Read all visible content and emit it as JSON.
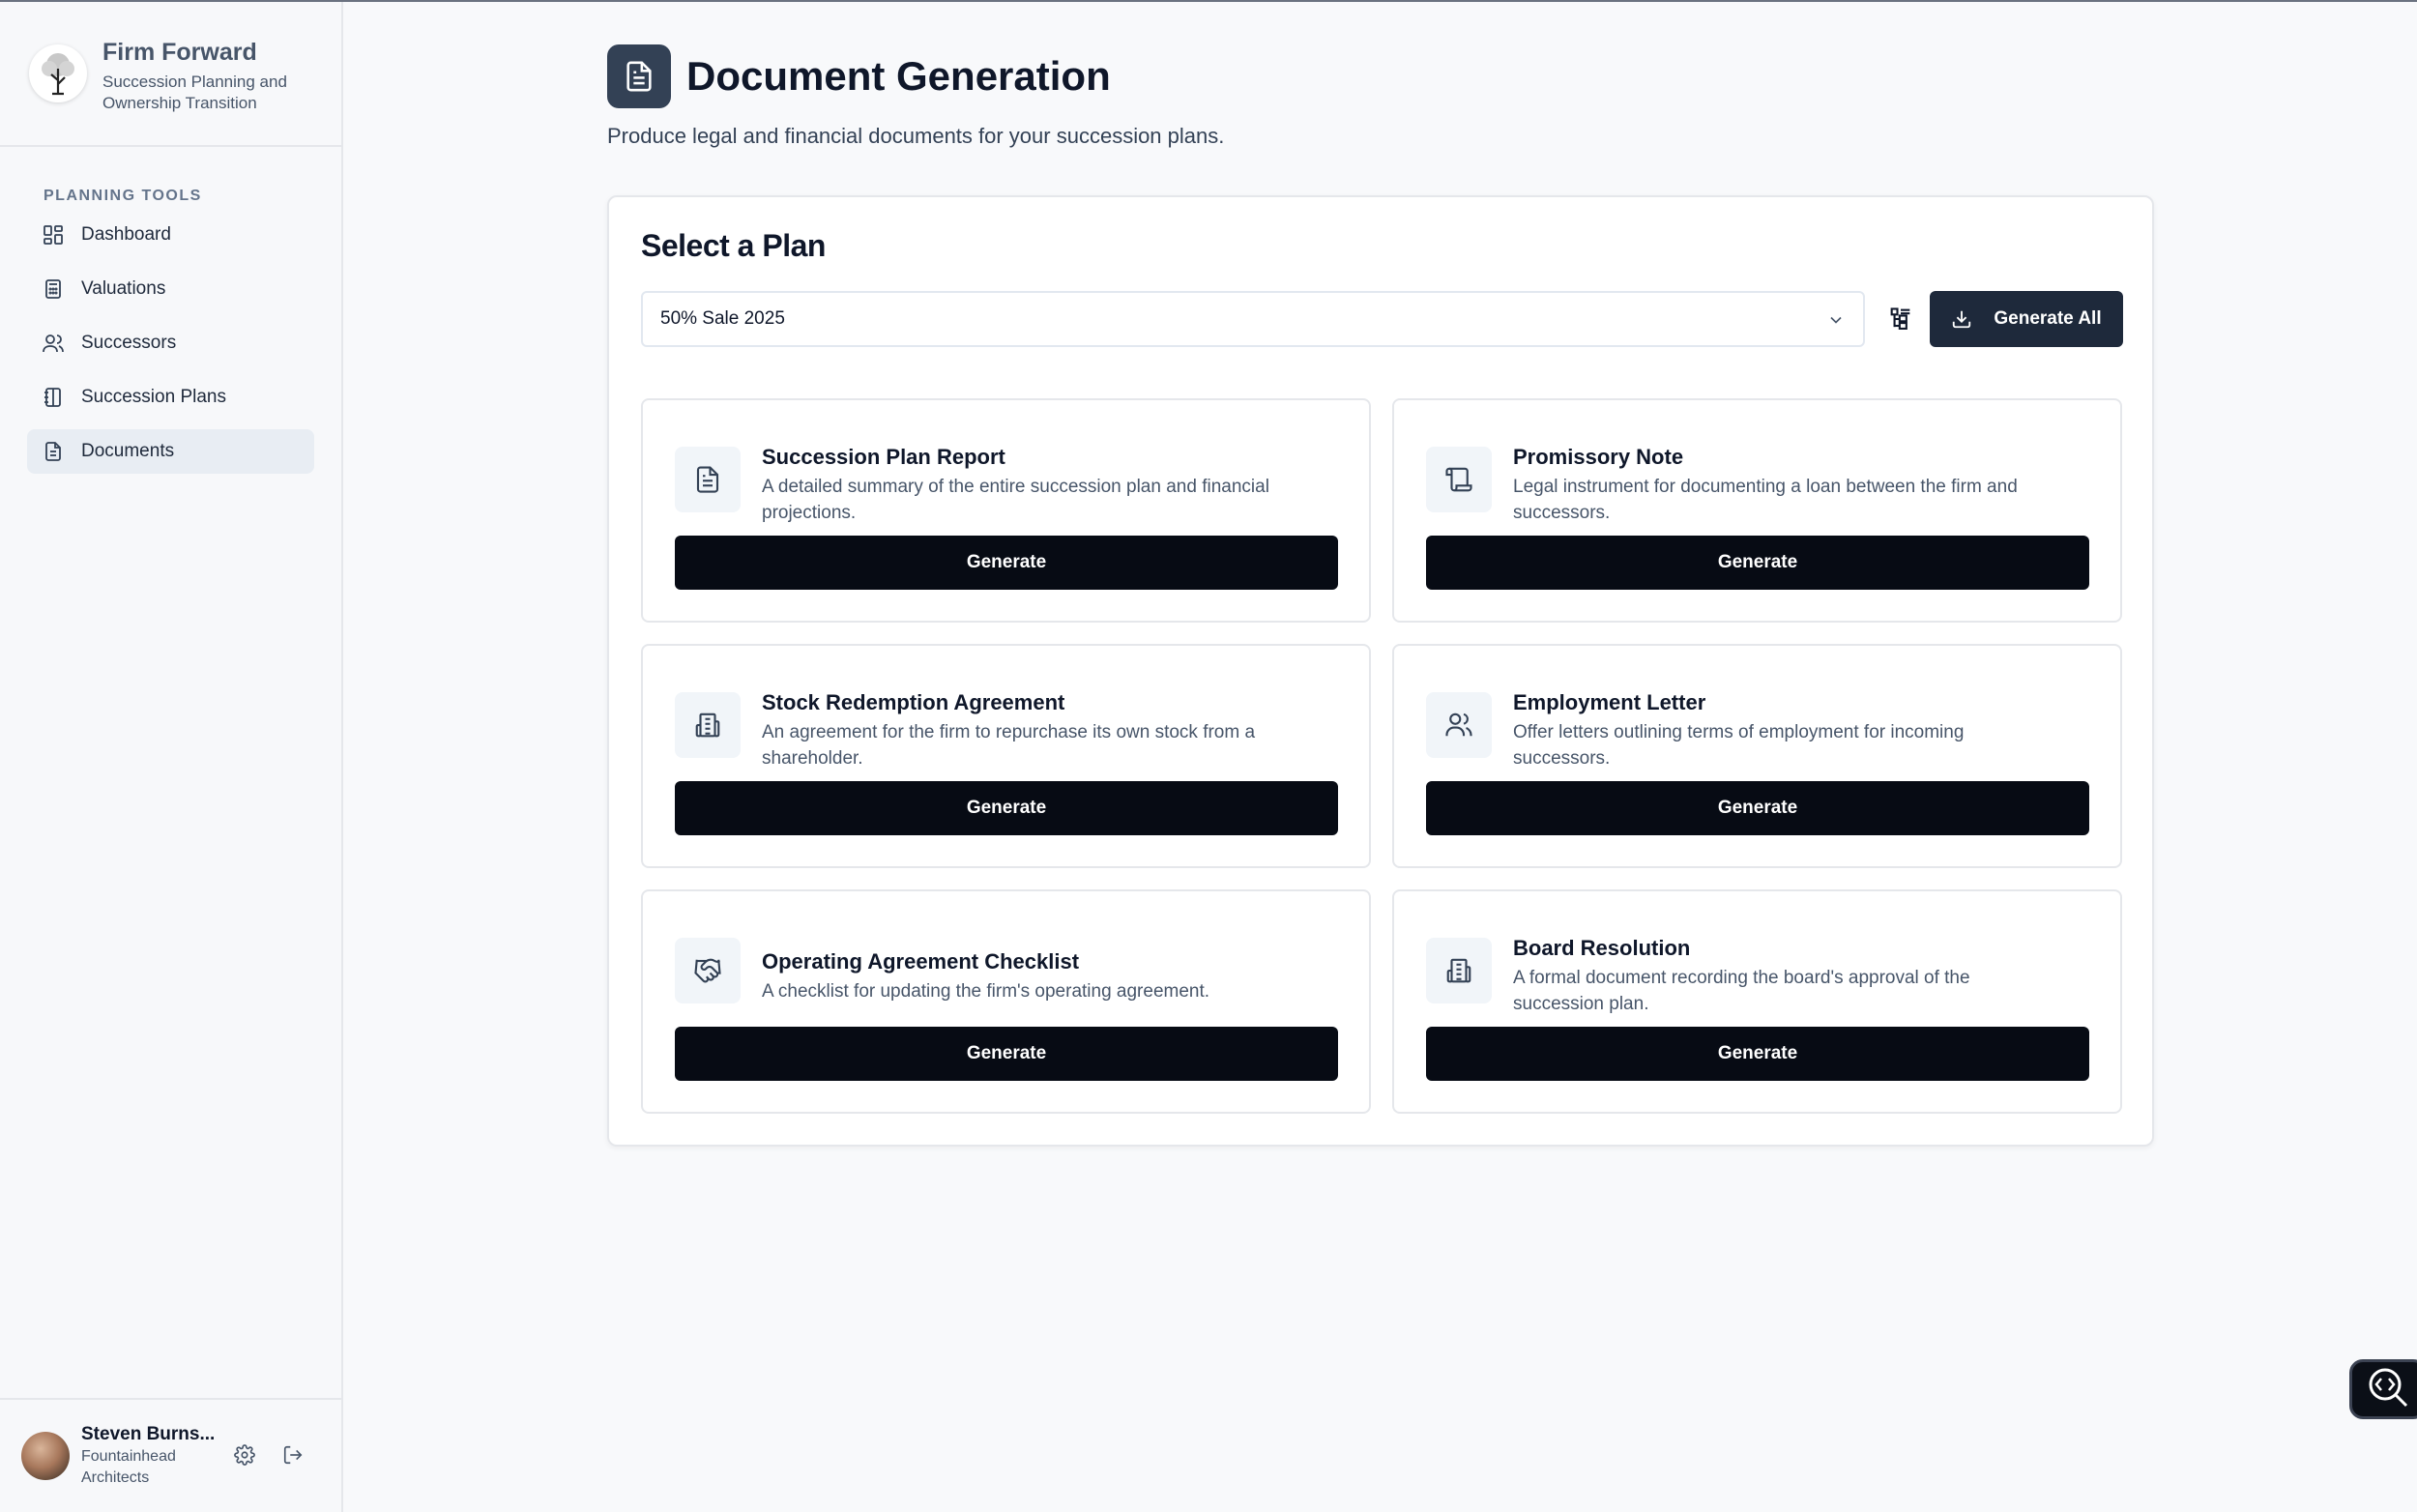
{
  "brand": {
    "title": "Firm Forward",
    "subtitle": "Succession Planning and Ownership Transition"
  },
  "sidebar": {
    "section_label": "PLANNING TOOLS",
    "items": [
      {
        "label": "Dashboard",
        "icon": "dashboard-icon"
      },
      {
        "label": "Valuations",
        "icon": "calculator-icon"
      },
      {
        "label": "Successors",
        "icon": "users-icon"
      },
      {
        "label": "Succession Plans",
        "icon": "notebook-icon"
      },
      {
        "label": "Documents",
        "icon": "document-icon",
        "active": true
      }
    ]
  },
  "user": {
    "name": "Steven Burns...",
    "org": "Fountainhead Architects"
  },
  "header": {
    "title": "Document Generation",
    "subtitle": "Produce legal and financial documents for your succession plans."
  },
  "plan": {
    "title": "Select a Plan",
    "selected": "50% Sale 2025",
    "generate_all_label": "Generate All"
  },
  "documents": [
    {
      "title": "Succession Plan Report",
      "desc": "A detailed summary of the entire succession plan and financial projections.",
      "button": "Generate",
      "icon": "file-text-icon"
    },
    {
      "title": "Promissory Note",
      "desc": "Legal instrument for documenting a loan between the firm and successors.",
      "button": "Generate",
      "icon": "scroll-icon"
    },
    {
      "title": "Stock Redemption Agreement",
      "desc": "An agreement for the firm to repurchase its own stock from a shareholder.",
      "button": "Generate",
      "icon": "building-icon"
    },
    {
      "title": "Employment Letter",
      "desc": "Offer letters outlining terms of employment for incoming successors.",
      "button": "Generate",
      "icon": "users-icon"
    },
    {
      "title": "Operating Agreement Checklist",
      "desc": "A checklist for updating the firm's operating agreement.",
      "button": "Generate",
      "icon": "handshake-icon"
    },
    {
      "title": "Board Resolution",
      "desc": "A formal document recording the board's approval of the succession plan.",
      "button": "Generate",
      "icon": "building-icon"
    }
  ],
  "colors": {
    "primary_button": "#070b14",
    "generate_all_button": "#1e293b",
    "active_nav": "#e8edf3"
  }
}
